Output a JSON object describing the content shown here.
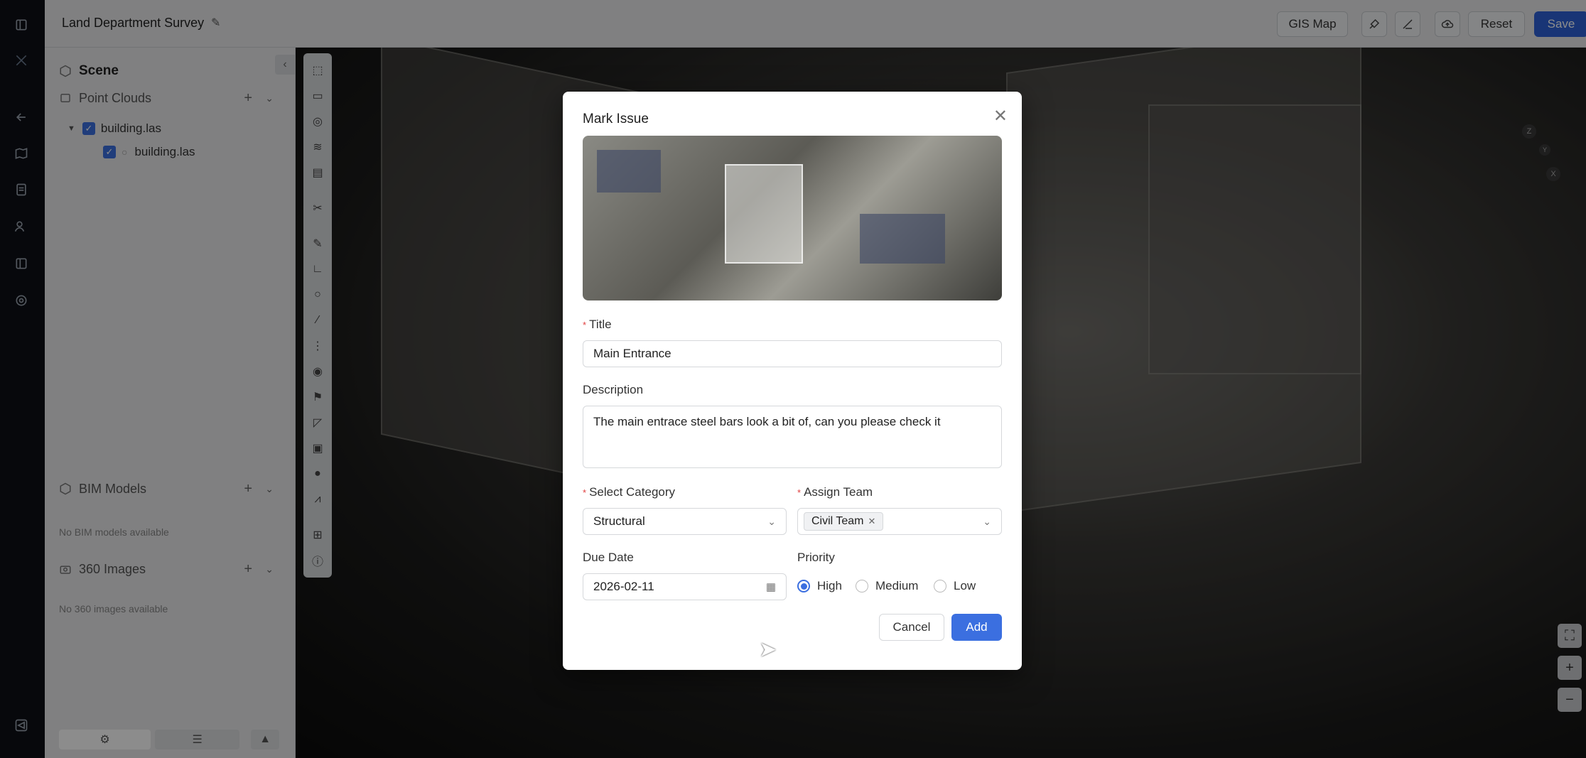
{
  "header": {
    "project_title": "Land Department Survey",
    "buttons": {
      "gis_map": "GIS Map",
      "reset": "Reset",
      "save": "Save"
    }
  },
  "rail": {
    "icons": [
      "sidebar-toggle-icon",
      "logo-icon",
      "back-arrow-icon",
      "map-icon",
      "document-icon",
      "users-icon",
      "board-icon",
      "settings-icon",
      "megaphone-icon"
    ]
  },
  "sidebar": {
    "scene_label": "Scene",
    "sections": {
      "point_clouds": {
        "label": "Point Clouds"
      },
      "bim_models": {
        "label": "BIM Models",
        "empty": "No BIM models available"
      },
      "images_360": {
        "label": "360 Images",
        "empty": "No 360 images available"
      }
    },
    "tree": {
      "parent": "building.las",
      "child": "building.las"
    }
  },
  "axis": {
    "z": "Z",
    "y": "Y",
    "x": "X"
  },
  "modal": {
    "title": "Mark Issue",
    "fields": {
      "title_label": "Title",
      "title_value": "Main Entrance",
      "description_label": "Description",
      "description_value": "The main entrace steel bars look a bit of, can you please check it",
      "category_label": "Select Category",
      "category_value": "Structural",
      "team_label": "Assign Team",
      "team_value": "Civil Team",
      "due_label": "Due Date",
      "due_value": "2026-02-11",
      "priority_label": "Priority",
      "priority_options": [
        "High",
        "Medium",
        "Low"
      ],
      "priority_selected": "High"
    },
    "buttons": {
      "cancel": "Cancel",
      "add": "Add"
    }
  }
}
